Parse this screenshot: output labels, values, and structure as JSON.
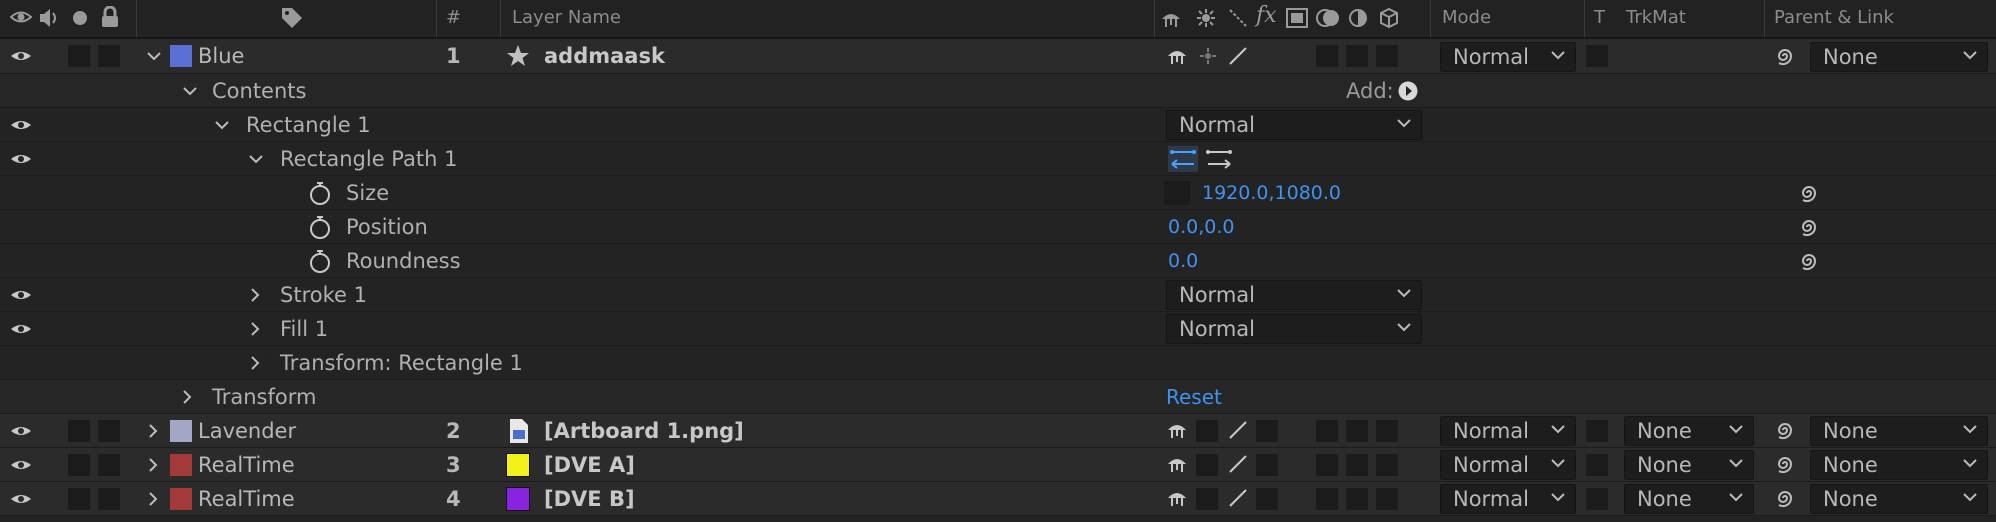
{
  "header": {
    "num": "#",
    "layer_name": "Layer Name",
    "mode": "Mode",
    "t": "T",
    "trkmat": "TrkMat",
    "parent_link": "Parent & Link",
    "fx": "fx"
  },
  "colors": {
    "label_blue": "#5b6fd6",
    "label_lavender": "#a4a6c8",
    "label_red": "#a23a3a",
    "dve_a": "#f2f21a",
    "dve_b": "#8a23e0",
    "accent_value": "#3f93ee"
  },
  "layer1": {
    "label_name": "Blue",
    "number": "1",
    "name": "addmaask",
    "mode": "Normal",
    "parent": "None"
  },
  "contents": {
    "label": "Contents",
    "add": "Add:",
    "rect": {
      "label": "Rectangle 1",
      "mode": "Normal"
    },
    "rect_path": {
      "label": "Rectangle Path 1"
    },
    "size": {
      "label": "Size",
      "value": "1920.0,1080.0"
    },
    "position": {
      "label": "Position",
      "value": "0.0,0.0"
    },
    "roundness": {
      "label": "Roundness",
      "value": "0.0"
    },
    "stroke": {
      "label": "Stroke 1",
      "mode": "Normal"
    },
    "fill": {
      "label": "Fill 1",
      "mode": "Normal"
    },
    "transform_rect": {
      "label": "Transform: Rectangle 1"
    }
  },
  "transform": {
    "label": "Transform",
    "reset": "Reset"
  },
  "layers": [
    {
      "label_name": "Lavender",
      "number": "2",
      "name": "[Artboard 1.png]",
      "mode": "Normal",
      "trkmat": "None",
      "parent": "None"
    },
    {
      "label_name": "RealTime",
      "number": "3",
      "name": "[DVE A]",
      "mode": "Normal",
      "trkmat": "None",
      "parent": "None"
    },
    {
      "label_name": "RealTime",
      "number": "4",
      "name": "[DVE B]",
      "mode": "Normal",
      "trkmat": "None",
      "parent": "None"
    }
  ]
}
